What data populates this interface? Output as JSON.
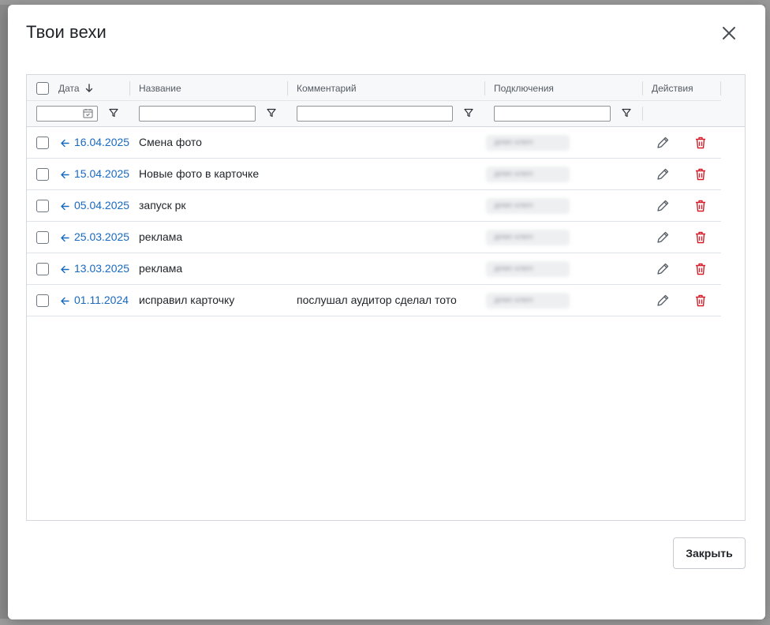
{
  "modal": {
    "title": "Твои вехи",
    "close_label": "Закрыть"
  },
  "table": {
    "columns": {
      "date": "Дата",
      "name": "Название",
      "comment": "Комментарий",
      "connections": "Подключения",
      "actions": "Действия"
    },
    "sort": {
      "column": "date",
      "direction": "descending"
    },
    "rows": [
      {
        "date": "16.04.2025",
        "name": "Смена фото",
        "comment": "",
        "connections": "демо ключ"
      },
      {
        "date": "15.04.2025",
        "name": "Новые фото в карточке",
        "comment": "",
        "connections": "демо ключ"
      },
      {
        "date": "05.04.2025",
        "name": "запуск рк",
        "comment": "",
        "connections": "демо ключ"
      },
      {
        "date": "25.03.2025",
        "name": "реклама",
        "comment": "",
        "connections": "демо ключ"
      },
      {
        "date": "13.03.2025",
        "name": "реклама",
        "comment": "",
        "connections": "демо ключ"
      },
      {
        "date": "01.11.2024",
        "name": "исправил карточку",
        "comment": "послушал аудитор сделал тото",
        "connections": "демо ключ"
      }
    ]
  },
  "icons": {
    "close": "close-icon",
    "sort": "arrow-down-icon",
    "filter": "filter-icon",
    "calendar": "calendar-icon",
    "row_arrow": "arrow-left-icon",
    "edit": "pencil-icon",
    "delete": "trash-icon"
  },
  "colors": {
    "link": "#1769c2",
    "delete": "#d3202d"
  }
}
